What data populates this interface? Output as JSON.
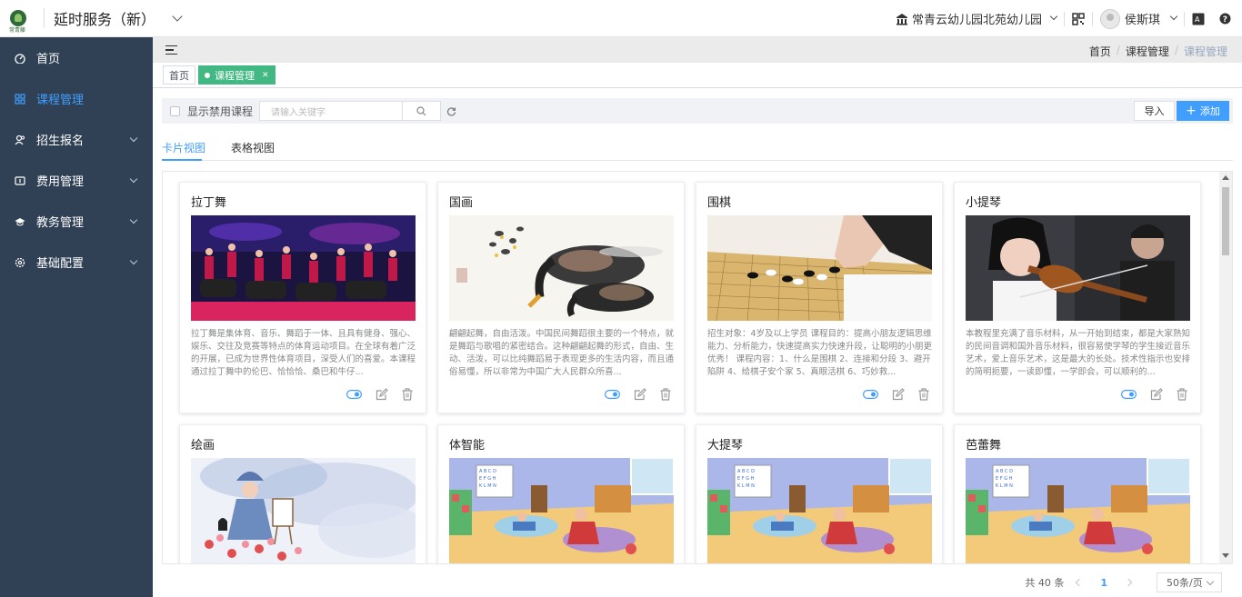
{
  "header": {
    "logo_text": "常青藤",
    "app_title": "延时服务（新）",
    "school": "常青云幼儿园北苑幼儿园",
    "user": "侯斯琪"
  },
  "sidebar": {
    "items": [
      {
        "label": "首页",
        "icon": "dashboard-icon"
      },
      {
        "label": "课程管理",
        "icon": "course-icon"
      },
      {
        "label": "招生报名",
        "icon": "users-icon"
      },
      {
        "label": "费用管理",
        "icon": "fee-icon"
      },
      {
        "label": "教务管理",
        "icon": "graduation-icon"
      },
      {
        "label": "基础配置",
        "icon": "settings-icon"
      }
    ]
  },
  "breadcrumb": {
    "home": "首页",
    "course": "课程管理",
    "current": "课程管理"
  },
  "tags": {
    "home": "首页",
    "current": "课程管理"
  },
  "toolbar": {
    "show_disabled_label": "显示禁用课程",
    "search_placeholder": "请输入关键字",
    "import_label": "导入",
    "add_label": "添加"
  },
  "view_tabs": {
    "card": "卡片视图",
    "table": "表格视图"
  },
  "cards": [
    {
      "title": "拉丁舞",
      "desc": "拉丁舞是集体育、音乐、舞蹈于一体、且具有健身、强心、娱乐、交往及竞赛等特点的体育运动项目。在全球有着广泛的开展，已成为世界性体育项目，深受人们的喜爱。本课程通过拉丁舞中的伦巴、恰恰恰、桑巴和牛仔..."
    },
    {
      "title": "国画",
      "desc": "翩翩起舞，自由活泼。中国民间舞蹈很主要的一个特点，就是舞蹈与歌唱的紧密结合。这种翩翩起舞的形式，自由、生动、活泼，可以比纯舞蹈易于表现更多的生活内容，而且通俗易懂，所以非常为中国广大人民群众所喜..."
    },
    {
      "title": "围棋",
      "desc": "招生对象：4岁及以上学员 课程目的：提高小朋友逻辑思维能力、分析能力，快速提高实力快速升段，让聪明的小朋更优秀！ 课程内容：1、什么是围棋 2、连接和分段 3、避开陷阱 4、给棋子安个家 5、真眼活棋 6、巧妙救..."
    },
    {
      "title": "小提琴",
      "desc": "本教程里充满了音乐材料，从一开始到结束，都是大家熟知的民间音调和国外音乐材料，很容易使学琴的学生接近音乐艺术，爱上音乐艺术，这是最大的长处。技术性指示也安排的简明扼要，一读即懂，一学即会，可以顺利的..."
    },
    {
      "title": "绘画",
      "desc": ""
    },
    {
      "title": "体智能",
      "desc": ""
    },
    {
      "title": "大提琴",
      "desc": ""
    },
    {
      "title": "芭蕾舞",
      "desc": ""
    }
  ],
  "pagination": {
    "total": "共 40 条",
    "current_page": "1",
    "page_size": "50条/页"
  },
  "colors": {
    "sidebar_bg": "#304156",
    "accent": "#409eff",
    "tag_active": "#42b983"
  }
}
